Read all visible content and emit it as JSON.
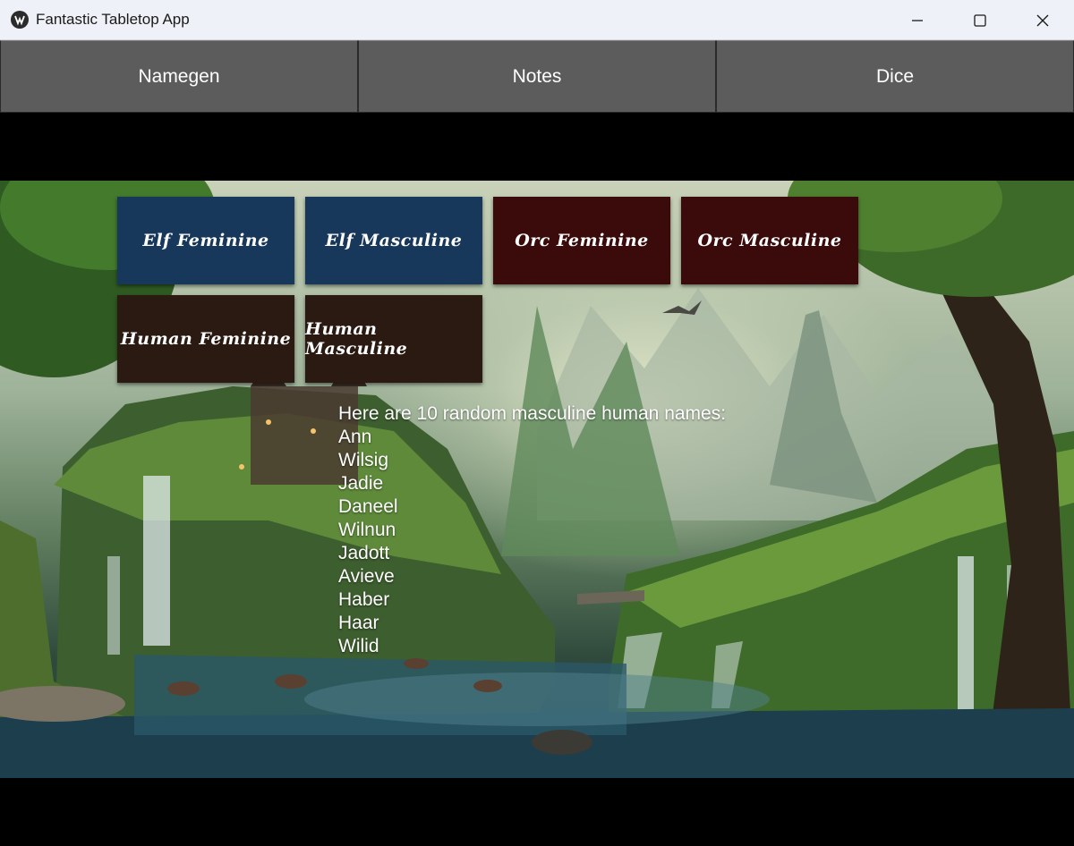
{
  "window": {
    "title": "Fantastic Tabletop App"
  },
  "nav": {
    "tabs": [
      {
        "label": "Namegen"
      },
      {
        "label": "Notes"
      },
      {
        "label": "Dice"
      }
    ]
  },
  "namegen": {
    "buttons": {
      "elf_feminine": "Elf Feminine",
      "elf_masculine": "Elf Masculine",
      "orc_feminine": "Orc Feminine",
      "orc_masculine": "Orc Masculine",
      "human_feminine": "Human Feminine",
      "human_masculine": "Human Masculine"
    },
    "output": {
      "heading": "Here are 10 random masculine human names:",
      "names": [
        "Ann",
        "Wilsig",
        "Jadie",
        "Daneel",
        "Wilnun",
        "Jadott",
        "Avieve",
        "Haber",
        "Haar",
        "Wilid"
      ]
    }
  },
  "colors": {
    "elf_button": "#17385a",
    "orc_button": "#3b0a0a",
    "human_button": "#2a1a12",
    "nav_tab": "#5c5c5c"
  },
  "icons": {
    "app": "app-logo-icon",
    "minimize": "minimize-icon",
    "maximize": "maximize-icon",
    "close": "close-icon"
  }
}
